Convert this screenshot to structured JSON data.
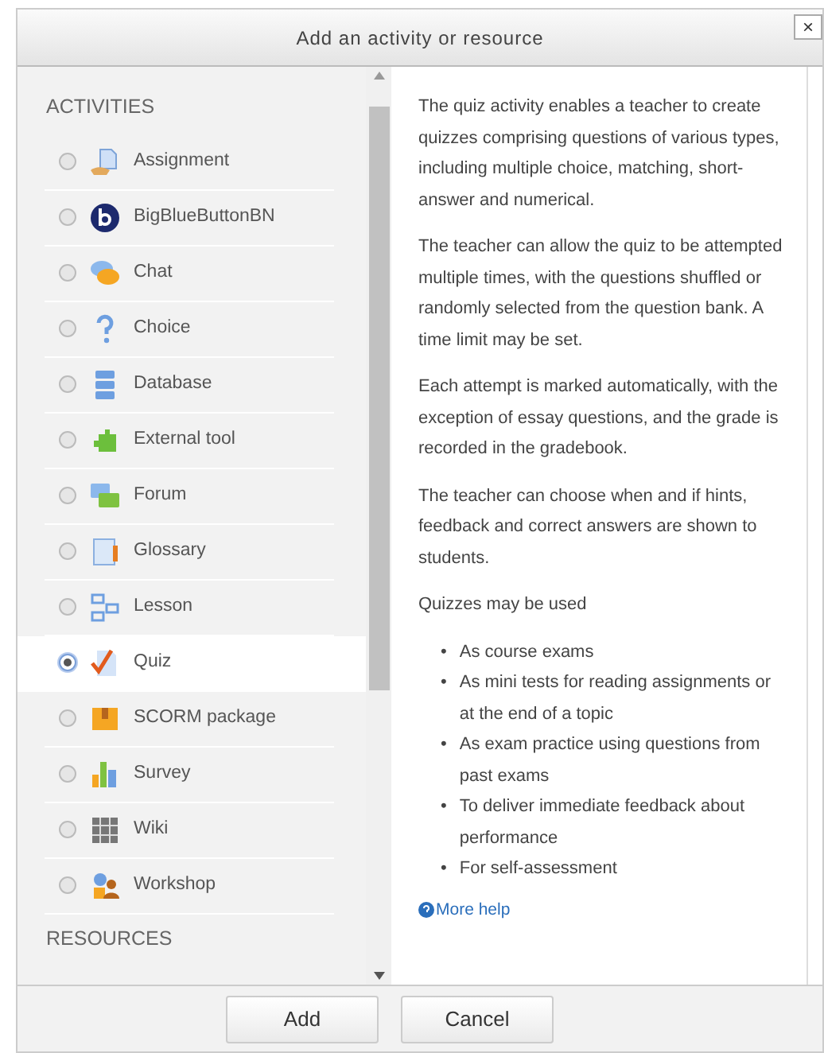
{
  "window": {
    "title": "Add an activity or resource",
    "close": "×"
  },
  "sections": [
    {
      "heading": "ACTIVITIES",
      "items": [
        {
          "label": "Assignment",
          "kind": "assignment",
          "selected": false
        },
        {
          "label": "BigBlueButtonBN",
          "kind": "bigbluebutton",
          "selected": false
        },
        {
          "label": "Chat",
          "kind": "chat",
          "selected": false
        },
        {
          "label": "Choice",
          "kind": "choice",
          "selected": false
        },
        {
          "label": "Database",
          "kind": "database",
          "selected": false
        },
        {
          "label": "External tool",
          "kind": "external",
          "selected": false
        },
        {
          "label": "Forum",
          "kind": "forum",
          "selected": false
        },
        {
          "label": "Glossary",
          "kind": "glossary",
          "selected": false
        },
        {
          "label": "Lesson",
          "kind": "lesson",
          "selected": false
        },
        {
          "label": "Quiz",
          "kind": "quiz",
          "selected": true
        },
        {
          "label": "SCORM package",
          "kind": "scorm",
          "selected": false
        },
        {
          "label": "Survey",
          "kind": "survey",
          "selected": false
        },
        {
          "label": "Wiki",
          "kind": "wiki",
          "selected": false
        },
        {
          "label": "Workshop",
          "kind": "workshop",
          "selected": false
        }
      ]
    },
    {
      "heading": "RESOURCES"
    }
  ],
  "description": {
    "paragraphs": [
      "The quiz activity enables a teacher to create quizzes comprising questions of various types, including multiple choice, matching, short-answer and numerical.",
      "The teacher can allow the quiz to be attempted multiple times, with the questions shuffled or randomly selected from the question bank. A time limit may be set.",
      "Each attempt is marked automatically, with the exception of essay questions, and the grade is recorded in the gradebook.",
      "The teacher can choose when and if hints, feedback and correct answers are shown to students.",
      "Quizzes may be used"
    ],
    "bullet_marker": "•",
    "bullets": [
      "As course exams",
      "As mini tests for reading assignments or at the end of a topic",
      "As exam practice using questions from past exams",
      "To deliver immediate feedback about performance",
      "For self-assessment"
    ],
    "help_link": "More help"
  },
  "buttons": [
    "Add",
    "Cancel"
  ]
}
